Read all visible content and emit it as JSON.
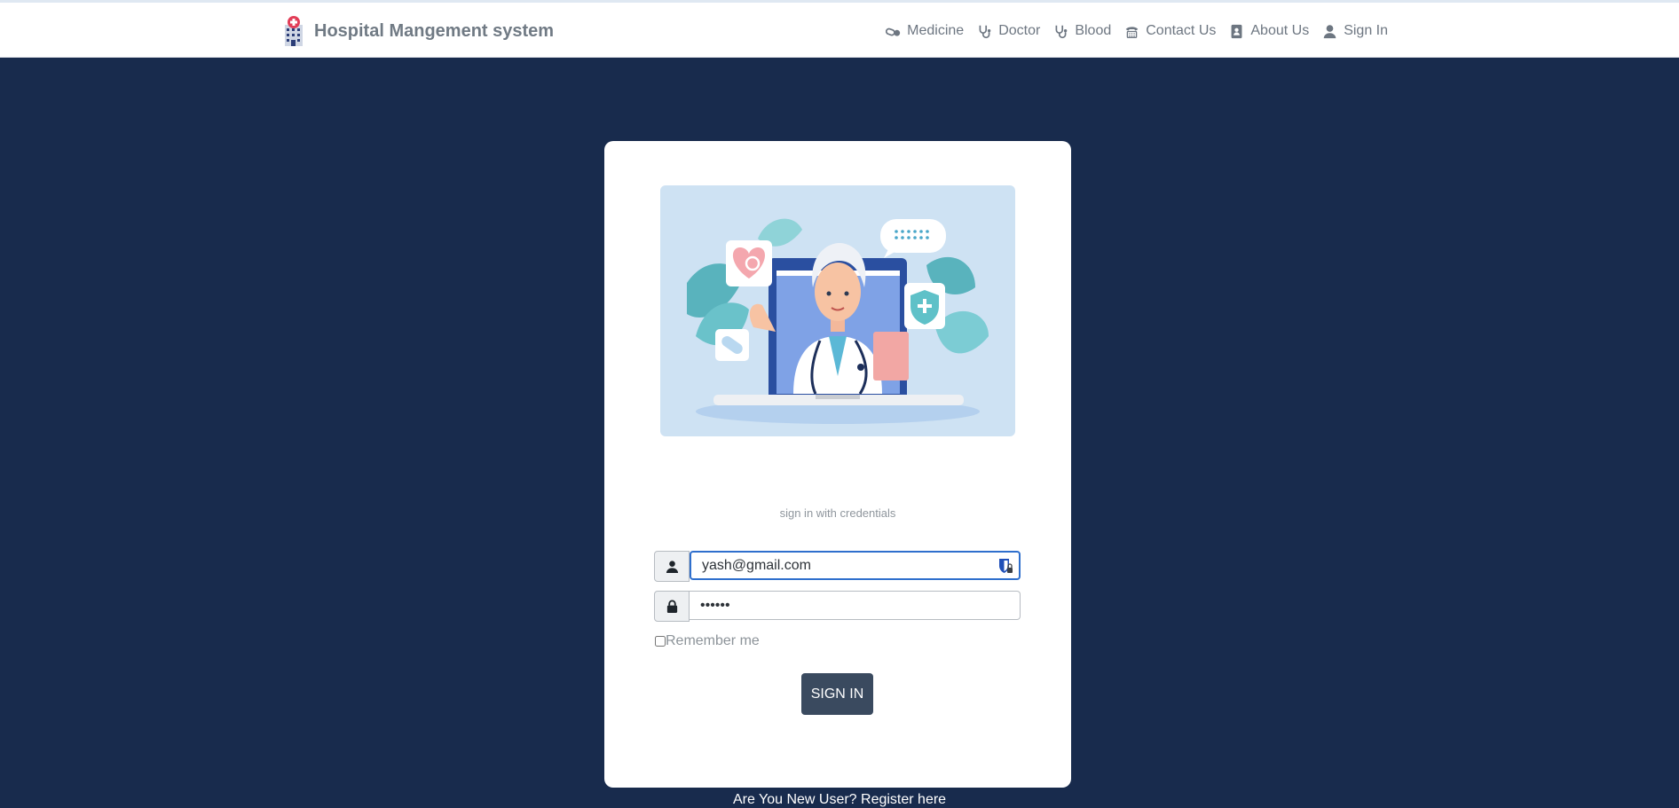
{
  "brand": {
    "title": "Hospital Mangement system",
    "logo_icon": "hospital-building-icon"
  },
  "nav": {
    "items": [
      {
        "label": "Medicine",
        "icon": "pills-icon"
      },
      {
        "label": "Doctor",
        "icon": "stethoscope-icon"
      },
      {
        "label": "Blood",
        "icon": "stethoscope-icon"
      },
      {
        "label": "Contact Us",
        "icon": "phone-icon"
      },
      {
        "label": "About Us",
        "icon": "address-book-icon"
      },
      {
        "label": "Sign In",
        "icon": "user-icon"
      }
    ]
  },
  "login": {
    "subtitle": "sign in with credentials",
    "email_value": "yash@gmail.com",
    "password_value": "••••••",
    "remember_label": "Remember me",
    "remember_checked": false,
    "submit_label": "SIGN IN"
  },
  "footer": {
    "register_text": "Are You New User? Register here"
  },
  "colors": {
    "background": "#182b4d",
    "navbar": "#ffffff",
    "button": "#3a4a5f",
    "focus": "#2f6fcd"
  }
}
